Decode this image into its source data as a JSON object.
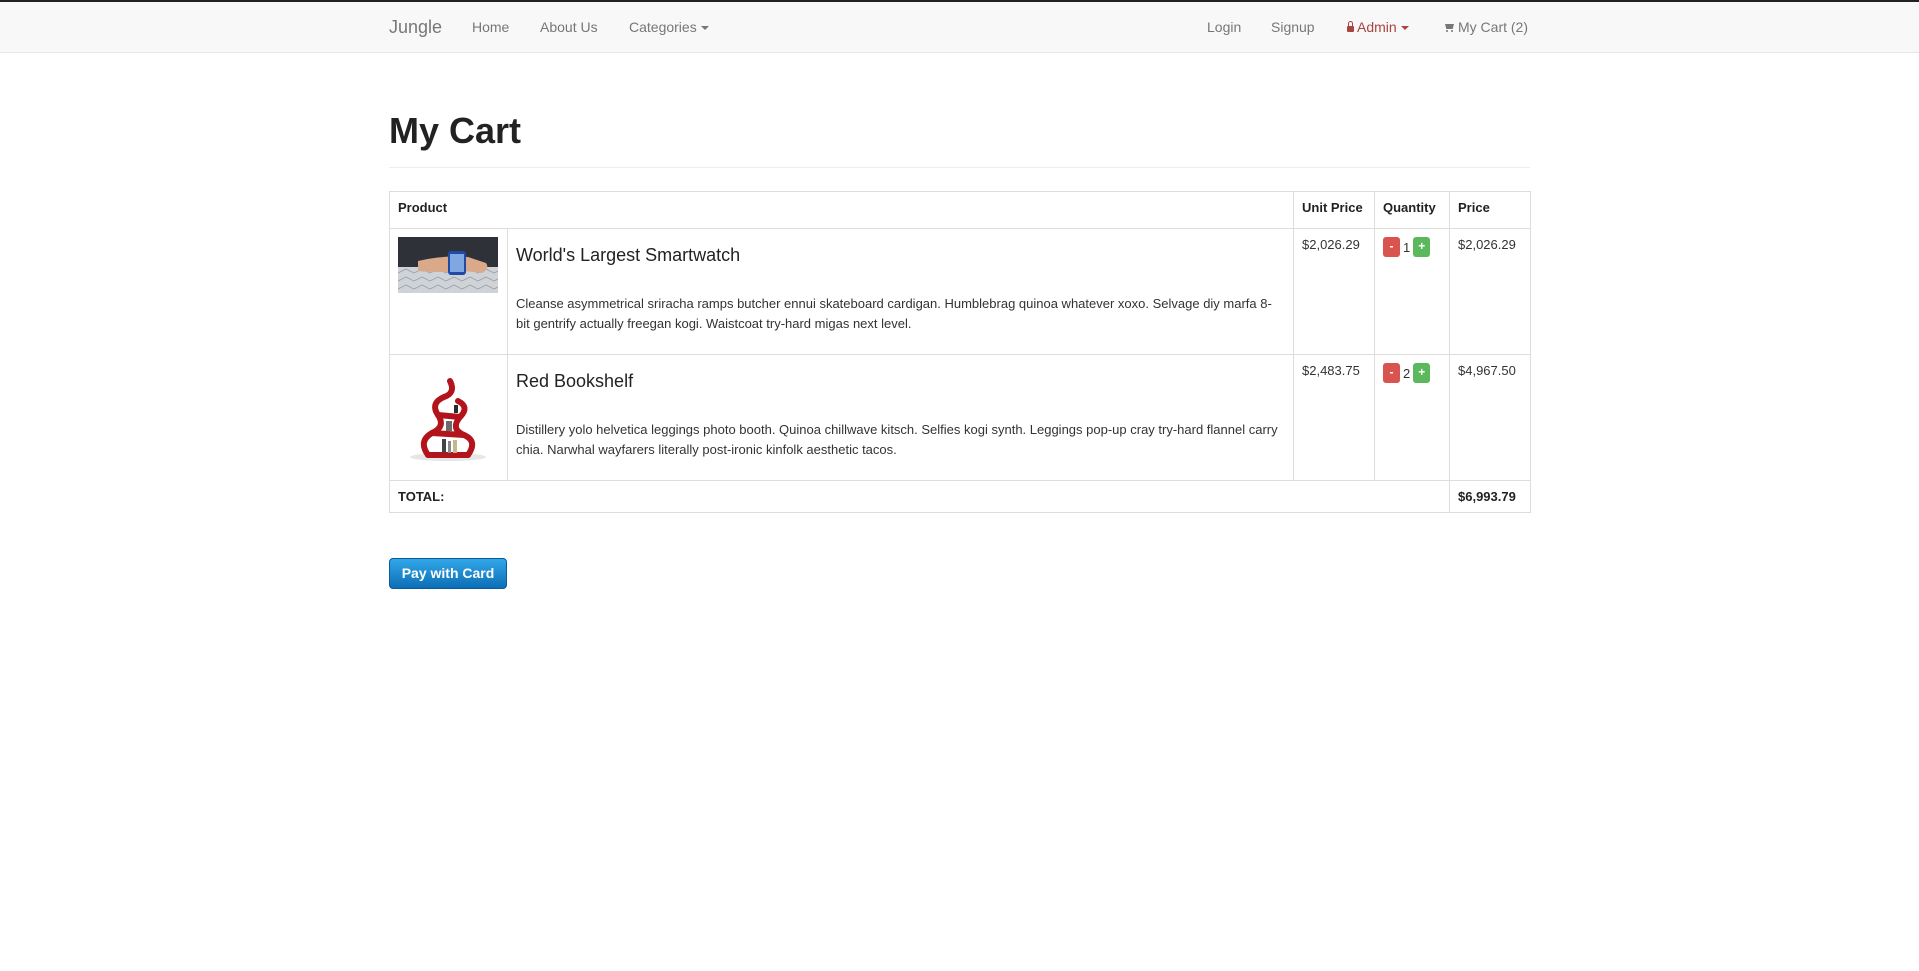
{
  "nav": {
    "brand": "Jungle",
    "links": [
      "Home",
      "About Us",
      "Categories"
    ],
    "right": {
      "login": "Login",
      "signup": "Signup",
      "admin": "Admin",
      "cart": "My Cart (2)"
    },
    "icons": {
      "admin": "lock-icon",
      "cart": "cart-icon"
    }
  },
  "page": {
    "title": "My Cart"
  },
  "table": {
    "headers": {
      "product": "Product",
      "unit_price": "Unit Price",
      "quantity": "Quantity",
      "price": "Price"
    },
    "rows": [
      {
        "name": "World's Largest Smartwatch",
        "description": "Cleanse asymmetrical sriracha ramps butcher ennui skateboard cardigan. Humblebrag quinoa whatever xoxo. Selvage diy marfa 8-bit gentrify actually freegan kogi. Waistcoat try-hard migas next level.",
        "unit_price": "$2,026.29",
        "quantity": "1",
        "price": "$2,026.29"
      },
      {
        "name": "Red Bookshelf",
        "description": "Distillery yolo helvetica leggings photo booth. Quinoa chillwave kitsch. Selfies kogi synth. Leggings pop-up cray try-hard flannel carry chia. Narwhal wayfarers literally post-ironic kinfolk aesthetic tacos.",
        "unit_price": "$2,483.75",
        "quantity": "2",
        "price": "$4,967.50"
      }
    ],
    "minus_label": "-",
    "plus_label": "+",
    "total_label": "TOTAL:",
    "total_amount": "$6,993.79"
  },
  "pay_button": "Pay with Card",
  "colors": {
    "danger": "#d9534f",
    "success": "#5cb85c",
    "primary": "#1a8fd6",
    "admin": "#a94442"
  }
}
